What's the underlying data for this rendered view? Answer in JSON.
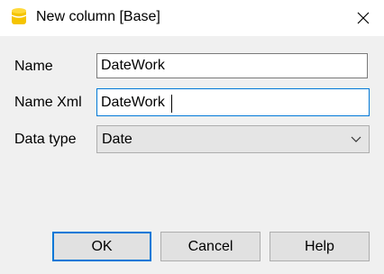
{
  "window": {
    "title": "New column [Base]",
    "app_icon": "database-icon",
    "close_icon": "close-icon"
  },
  "form": {
    "name": {
      "label": "Name",
      "value": "DateWork"
    },
    "name_xml": {
      "label": "Name Xml",
      "value": "DateWork"
    },
    "data_type": {
      "label": "Data type",
      "value": "Date"
    }
  },
  "buttons": {
    "ok": "OK",
    "cancel": "Cancel",
    "help": "Help"
  },
  "colors": {
    "accent": "#0078d7",
    "icon": "#f5c400"
  }
}
